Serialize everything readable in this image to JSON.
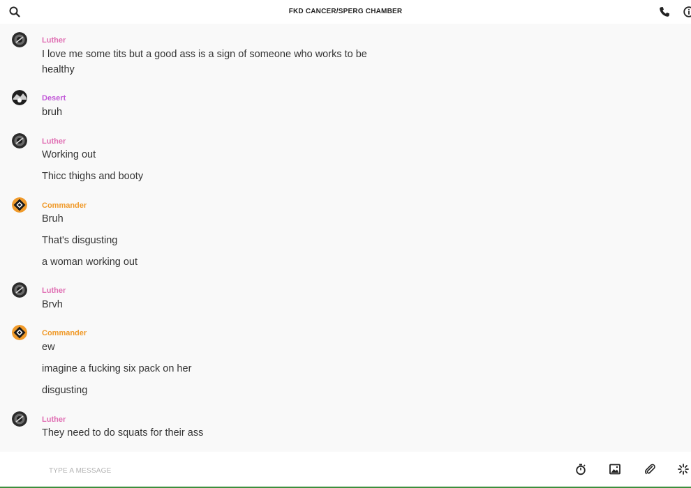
{
  "header": {
    "title": "FKD CANCER/SPERG CHAMBER",
    "icons": [
      "search-icon",
      "phone-icon",
      "info-icon"
    ]
  },
  "colors": {
    "luther": "#e06fb3",
    "desert": "#c25ad8",
    "commander": "#f09a2a",
    "footer_line": "#3c8f3c"
  },
  "messages": [
    {
      "author": "Luther",
      "lines": [
        "I love me some tits but a good ass is a sign of someone who works to be healthy"
      ]
    },
    {
      "author": "Desert",
      "lines": [
        "bruh"
      ]
    },
    {
      "author": "Luther",
      "lines": [
        "Working out",
        "Thicc thighs and booty"
      ]
    },
    {
      "author": "Commander",
      "lines": [
        "Bruh",
        "That's disgusting",
        "a woman working out"
      ]
    },
    {
      "author": "Luther",
      "lines": [
        "Brvh"
      ]
    },
    {
      "author": "Commander",
      "lines": [
        "ew",
        "imagine a fucking six pack on her",
        "disgusting"
      ]
    },
    {
      "author": "Luther",
      "lines": [
        "They need to do squats for their ass"
      ]
    }
  ],
  "composer": {
    "placeholder": "TYPE A MESSAGE",
    "icons": [
      "timer-icon",
      "image-icon",
      "paperclip-icon",
      "sparkle-icon"
    ]
  }
}
